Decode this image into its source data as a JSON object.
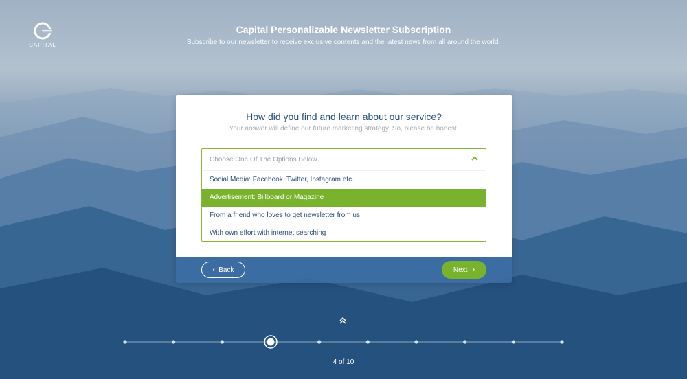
{
  "header": {
    "brand": "CAPITAL",
    "title": "Capital Personalizable Newsletter Subscription",
    "subtitle": "Subscribe to our newsletter to receive exclusive contents and the latest news from all around the world."
  },
  "question": {
    "title": "How did you find and learn about our service?",
    "subtitle": "Your answer will define our future marketing strategy. So, please be honest."
  },
  "select": {
    "placeholder": "Choose One Of The Options Below",
    "options": [
      "Social Media: Facebook, Twitter, Instagram etc.",
      "Advertisement: Billboard or Magazine",
      "From a friend who loves to get newsletter from us",
      "With own effort with internet searching"
    ],
    "highlighted_index": 1
  },
  "nav": {
    "back_label": "Back",
    "next_label": "Next"
  },
  "progress": {
    "current": 4,
    "total": 10,
    "label": "4 of 10"
  },
  "colors": {
    "accent": "#79b32d",
    "heading": "#274f7d",
    "footer": "#3c6ea5"
  },
  "icons": [
    "capital-logo",
    "chevron-up-icon",
    "chevron-left-icon",
    "chevron-right-icon",
    "double-chevron-up-icon"
  ]
}
